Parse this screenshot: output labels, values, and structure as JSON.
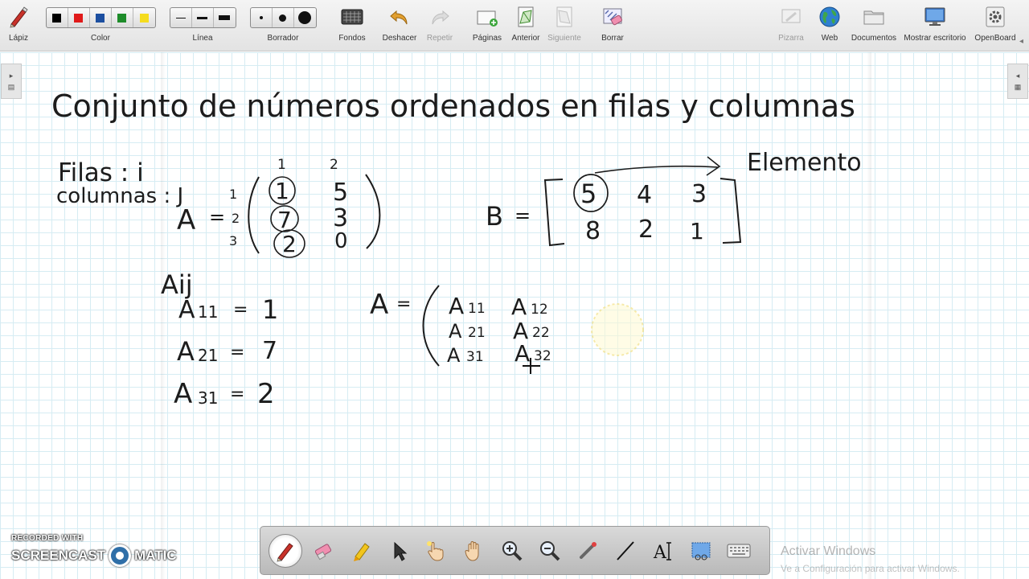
{
  "toolbar": {
    "pen_label": "Lápiz",
    "color_label": "Color",
    "colors": [
      "#000000",
      "#e01a1a",
      "#1c4fa0",
      "#1e8c2a",
      "#f5dc1e"
    ],
    "line_label": "Línea",
    "eraser_label": "Borrador",
    "backgrounds_label": "Fondos",
    "undo_label": "Deshacer",
    "redo_label": "Repetir",
    "pages_label": "Páginas",
    "previous_label": "Anterior",
    "next_label": "Siguiente",
    "clear_label": "Borrar",
    "board_label": "Pizarra",
    "web_label": "Web",
    "documents_label": "Documentos",
    "desktop_label": "Mostrar escritorio",
    "openboard_label": "OpenBoard"
  },
  "board": {
    "title": "Conjunto de números ordenados en filas y columnas",
    "rows_note": "Filas : i",
    "cols_note": "columnas : J",
    "matrix_a": {
      "name": "A",
      "col_indices": [
        "1",
        "2"
      ],
      "row_indices": [
        "1",
        "2",
        "3"
      ],
      "rows": [
        [
          "1",
          "5"
        ],
        [
          "7",
          "3"
        ],
        [
          "2",
          "0"
        ]
      ]
    },
    "matrix_b": {
      "name": "B",
      "rows": [
        [
          "5",
          "4",
          "3"
        ],
        [
          "8",
          "2",
          "1"
        ]
      ]
    },
    "element_label": "Elemento",
    "aij_label": "Aij",
    "examples": [
      {
        "name": "A",
        "sub": "11",
        "value": "1"
      },
      {
        "name": "A",
        "sub": "21",
        "value": "7"
      },
      {
        "name": "A",
        "sub": "31",
        "value": "2"
      }
    ],
    "general_matrix": {
      "name": "A",
      "rows": [
        [
          {
            "n": "A",
            "s": "11"
          },
          {
            "n": "A",
            "s": "12"
          }
        ],
        [
          {
            "n": "A",
            "s": "21"
          },
          {
            "n": "A",
            "s": "22"
          }
        ],
        [
          {
            "n": "A",
            "s": "31"
          },
          {
            "n": "A",
            "s": "32"
          }
        ]
      ]
    }
  },
  "watermark": {
    "activate_title": "Activar Windows",
    "activate_sub": "Ve a Configuración para activar Windows.",
    "recorded_with": "RECORDED WITH",
    "screencast_a": "SCREENCAST",
    "screencast_b": "MATIC"
  }
}
